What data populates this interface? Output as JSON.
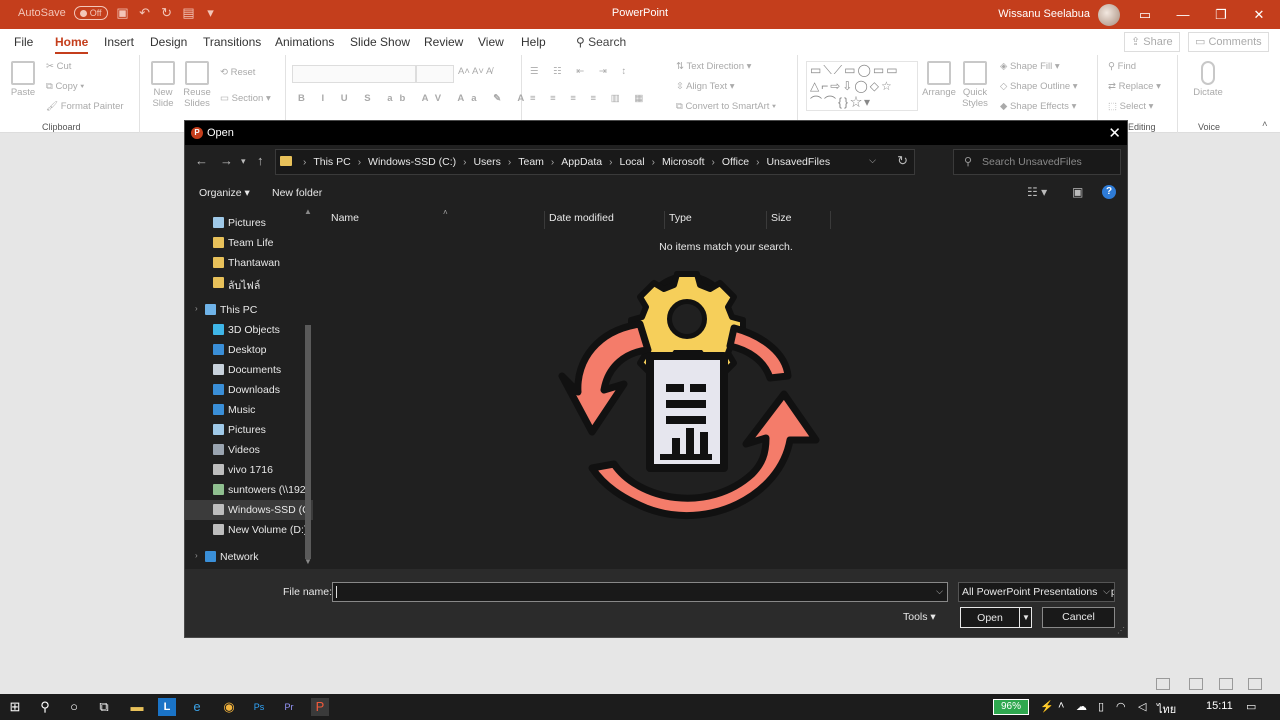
{
  "app": {
    "title": "PowerPoint",
    "autosave_label": "AutoSave",
    "autosave_state": "Off",
    "user_name": "Wissanu Seelabua"
  },
  "ribbon": {
    "tabs": [
      "File",
      "Home",
      "Insert",
      "Design",
      "Transitions",
      "Animations",
      "Slide Show",
      "Review",
      "View",
      "Help"
    ],
    "active_tab": "Home",
    "search_label": "Search",
    "share_label": "Share",
    "comments_label": "Comments",
    "clipboard": {
      "paste": "Paste",
      "cut": "Cut",
      "copy": "Copy",
      "format_painter": "Format Painter",
      "group_label": "Clipboard"
    },
    "slides": {
      "new_slide": "New Slide",
      "reuse_slides": "Reuse Slides",
      "reset": "Reset",
      "section": "Section"
    },
    "paragraph": {
      "text_direction": "Text Direction",
      "align_text": "Align Text",
      "convert_smartart": "Convert to SmartArt"
    },
    "drawing": {
      "arrange": "Arrange",
      "quick_styles": "Quick Styles",
      "shape_fill": "Shape Fill",
      "shape_outline": "Shape Outline",
      "shape_effects": "Shape Effects"
    },
    "editing": {
      "find": "Find",
      "replace": "Replace",
      "select": "Select",
      "group_label": "Editing"
    },
    "voice": {
      "dictate": "Dictate",
      "group_label": "Voice"
    }
  },
  "dialog": {
    "title": "Open",
    "breadcrumbs": [
      "This PC",
      "Windows-SSD (C:)",
      "Users",
      "Team",
      "AppData",
      "Local",
      "Microsoft",
      "Office",
      "UnsavedFiles"
    ],
    "search_placeholder": "Search UnsavedFiles",
    "organize_label": "Organize",
    "new_folder_label": "New folder",
    "nav_items": [
      {
        "label": "Pictures",
        "icon": "pictures-icon"
      },
      {
        "label": "Team Life",
        "icon": "folder-icon"
      },
      {
        "label": "Thantawan",
        "icon": "folder-icon"
      },
      {
        "label": "ลับไฟล์",
        "icon": "folder-icon"
      },
      {
        "label": "This PC",
        "icon": "pc-icon"
      },
      {
        "label": "3D Objects",
        "icon": "3d-objects-icon"
      },
      {
        "label": "Desktop",
        "icon": "desktop-icon"
      },
      {
        "label": "Documents",
        "icon": "documents-icon"
      },
      {
        "label": "Downloads",
        "icon": "downloads-icon"
      },
      {
        "label": "Music",
        "icon": "music-icon"
      },
      {
        "label": "Pictures",
        "icon": "pictures-icon"
      },
      {
        "label": "Videos",
        "icon": "videos-icon"
      },
      {
        "label": "vivo 1716",
        "icon": "phone-icon"
      },
      {
        "label": "suntowers (\\\\192",
        "icon": "network-drive-icon"
      },
      {
        "label": "Windows-SSD (C",
        "icon": "drive-icon"
      },
      {
        "label": "New Volume (D:)",
        "icon": "drive-icon"
      },
      {
        "label": "Network",
        "icon": "network-icon"
      }
    ],
    "columns": [
      "Name",
      "Date modified",
      "Type",
      "Size"
    ],
    "empty_message": "No items match your search.",
    "file_name_label": "File name:",
    "file_name_value": "",
    "file_type_filter": "All PowerPoint Presentations (*.pptx",
    "tools_label": "Tools",
    "open_label": "Open",
    "cancel_label": "Cancel"
  },
  "taskbar": {
    "battery_percent": "96%",
    "language": "ไทย",
    "time": "15:11"
  },
  "colors": {
    "brand": "#c43e1c",
    "dialog_bg": "#202020",
    "accent_blue": "#2e7bd6",
    "arrow_salmon": "#f47c6a",
    "gear_yellow": "#f6cf5a"
  }
}
